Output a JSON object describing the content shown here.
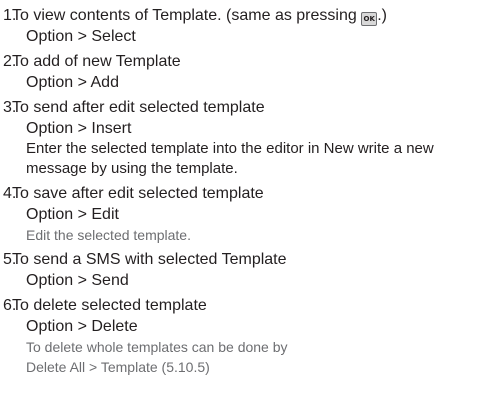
{
  "items": [
    {
      "number": "1.",
      "heading_before": "To view contents of Template. (same as pressing ",
      "heading_icon": "ok-key-icon",
      "heading_icon_text": "OK",
      "heading_after": ".)",
      "option": "Option > Select"
    },
    {
      "number": "2.",
      "heading": "To add of new Template",
      "option": "Option > Add"
    },
    {
      "number": "3.",
      "heading": "To send after edit selected template",
      "option": "Option > Insert",
      "description_line1": "Enter the selected template into the editor in New write a new",
      "description_line2": "message by using the template."
    },
    {
      "number": "4.",
      "heading": "To save after edit selected template",
      "option": "Option > Edit",
      "note": "Edit the selected template."
    },
    {
      "number": "5.",
      "heading": "To send a SMS with selected Template",
      "option": "Option > Send"
    },
    {
      "number": "6.",
      "heading": "To delete selected template",
      "option": "Option > Delete",
      "note_line1": "To delete whole templates can be done by",
      "note_line2": "Delete All > Template (5.10.5)"
    }
  ]
}
